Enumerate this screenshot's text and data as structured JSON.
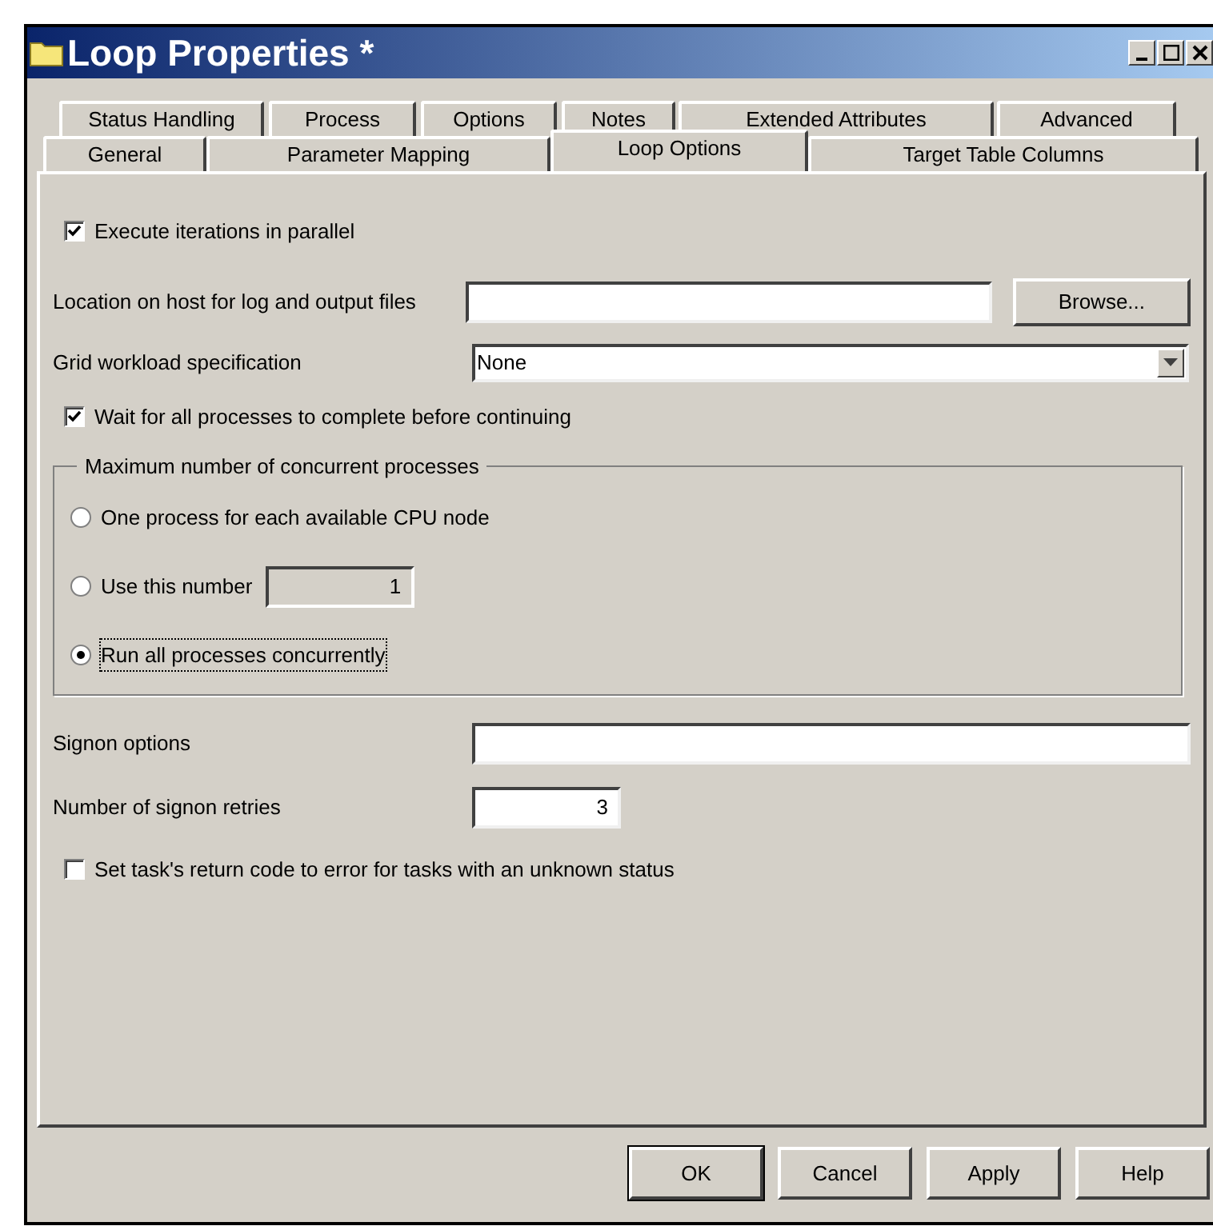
{
  "window": {
    "title": "Loop Properties *"
  },
  "tab_rows": [
    [
      {
        "label": "Status Handling",
        "selected": false
      },
      {
        "label": "Process",
        "selected": false
      },
      {
        "label": "Options",
        "selected": false
      },
      {
        "label": "Notes",
        "selected": false
      },
      {
        "label": "Extended Attributes",
        "selected": false
      },
      {
        "label": "Advanced",
        "selected": false
      }
    ],
    [
      {
        "label": "General",
        "selected": false
      },
      {
        "label": "Parameter Mapping",
        "selected": false
      },
      {
        "label": "Loop Options",
        "selected": true
      },
      {
        "label": "Target Table Columns",
        "selected": false
      }
    ]
  ],
  "execute_parallel": {
    "label": "Execute iterations in parallel",
    "checked": true
  },
  "location": {
    "label": "Location on host for log and output files",
    "button": "Browse..."
  },
  "grid_workload": {
    "label": "Grid workload specification",
    "value": "None"
  },
  "wait_all": {
    "label": "Wait for all processes to complete before continuing",
    "checked": true
  },
  "max_processes": {
    "title": "Maximum number of concurrent processes",
    "options": [
      {
        "label": "One process for each available CPU node",
        "selected": false
      },
      {
        "label": "Use this number",
        "selected": false,
        "value": "1"
      },
      {
        "label": "Run all processes concurrently",
        "selected": true
      }
    ]
  },
  "signon_options": {
    "label": "Signon options"
  },
  "signon_retries": {
    "label": "Number of signon retries",
    "value": "3"
  },
  "return_code": {
    "label": "Set task's return code to error for tasks with an unknown status",
    "checked": false
  },
  "buttons": [
    "OK",
    "Cancel",
    "Apply",
    "Help"
  ]
}
